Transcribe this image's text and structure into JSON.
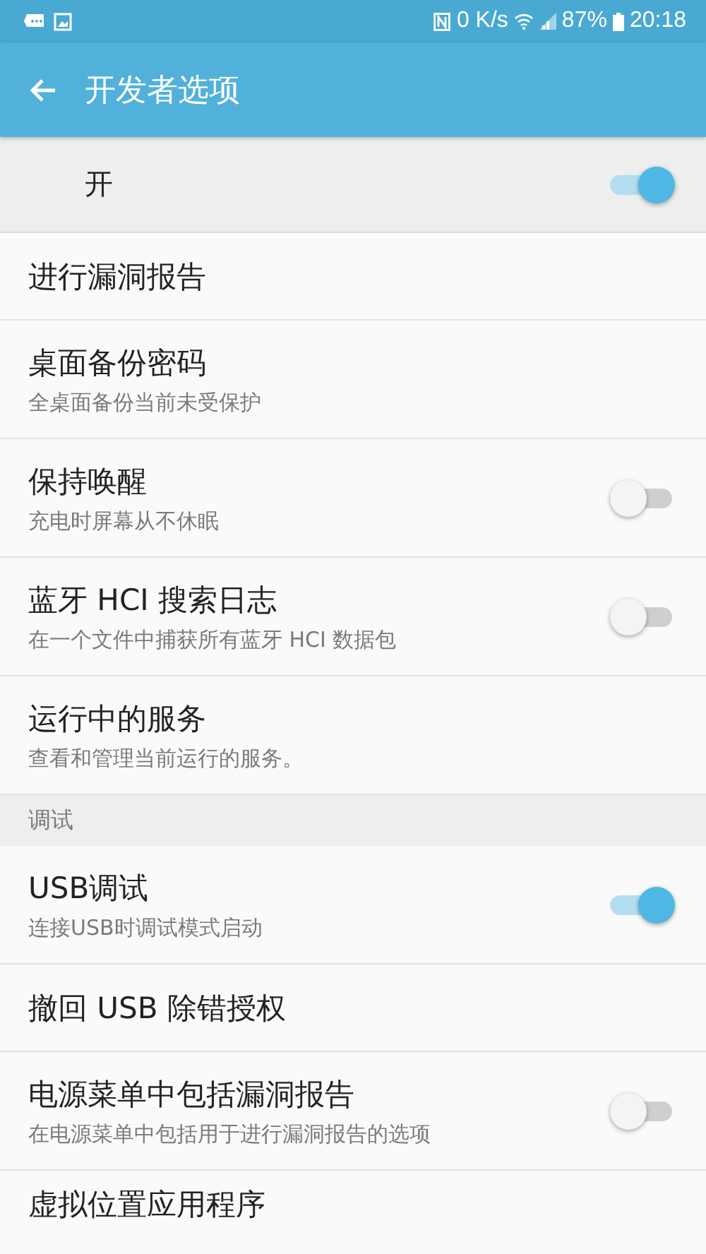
{
  "status_bar": {
    "data_rate": "0 K/s",
    "battery": "87%",
    "time": "20:18"
  },
  "app_bar": {
    "title": "开发者选项"
  },
  "master_switch": {
    "label": "开",
    "on": true
  },
  "items": [
    {
      "kind": "plain",
      "title": "进行漏洞报告"
    },
    {
      "kind": "plain",
      "title": "桌面备份密码",
      "summary": "全桌面备份当前未受保护"
    },
    {
      "kind": "switch",
      "title": "保持唤醒",
      "summary": "充电时屏幕从不休眠",
      "on": false
    },
    {
      "kind": "switch",
      "title": "蓝牙 HCI 搜索日志",
      "summary": "在一个文件中捕获所有蓝牙 HCI 数据包",
      "on": false
    },
    {
      "kind": "plain",
      "title": "运行中的服务",
      "summary": "查看和管理当前运行的服务。"
    },
    {
      "kind": "header",
      "title": "调试"
    },
    {
      "kind": "switch",
      "title": "USB调试",
      "summary": "连接USB时调试模式启动",
      "on": true
    },
    {
      "kind": "plain",
      "title": "撤回 USB 除错授权"
    },
    {
      "kind": "switch",
      "title": "电源菜单中包括漏洞报告",
      "summary": "在电源菜单中包括用于进行漏洞报告的选项",
      "on": false
    },
    {
      "kind": "plain",
      "title": "虚拟位置应用程序"
    }
  ]
}
